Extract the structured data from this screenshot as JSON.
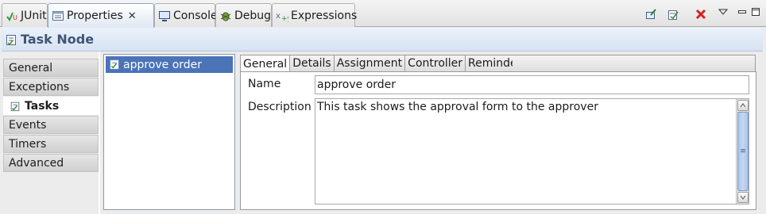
{
  "tabs": [
    {
      "label": "JUnit",
      "icon": "junit-icon"
    },
    {
      "label": "Properties",
      "icon": "properties-icon",
      "active": true,
      "close": "✕"
    },
    {
      "label": "Console",
      "icon": "console-icon"
    },
    {
      "label": "Debug",
      "icon": "debug-icon"
    },
    {
      "label": "Expressions",
      "icon": "expressions-icon"
    }
  ],
  "toolbar": {
    "icons": [
      "pin-view-icon",
      "new-view-icon",
      "remove-icon",
      "view-menu-icon",
      "minimize-icon",
      "maximize-icon"
    ]
  },
  "title": {
    "label": "Task Node",
    "icon": "task-node-icon"
  },
  "categories": [
    {
      "label": "General"
    },
    {
      "label": "Exceptions"
    },
    {
      "label": "Tasks",
      "active": true,
      "icon": "task-icon"
    },
    {
      "label": "Events"
    },
    {
      "label": "Timers"
    },
    {
      "label": "Advanced"
    }
  ],
  "node_list": {
    "items": [
      {
        "label": "approve order",
        "selected": true,
        "icon": "task-icon"
      }
    ]
  },
  "detail_tabs": [
    {
      "label": "General",
      "active": true
    },
    {
      "label": "Details"
    },
    {
      "label": "Assignment"
    },
    {
      "label": "Controller"
    },
    {
      "label": "Reminder"
    }
  ],
  "form": {
    "name_label": "Name",
    "name_value": "approve order",
    "description_label": "Description",
    "description_value": "This task shows the approval form to the approver"
  },
  "colors": {
    "selection": "#4a73b8",
    "title_text": "#3e5573",
    "remove_red": "#d8201c"
  }
}
